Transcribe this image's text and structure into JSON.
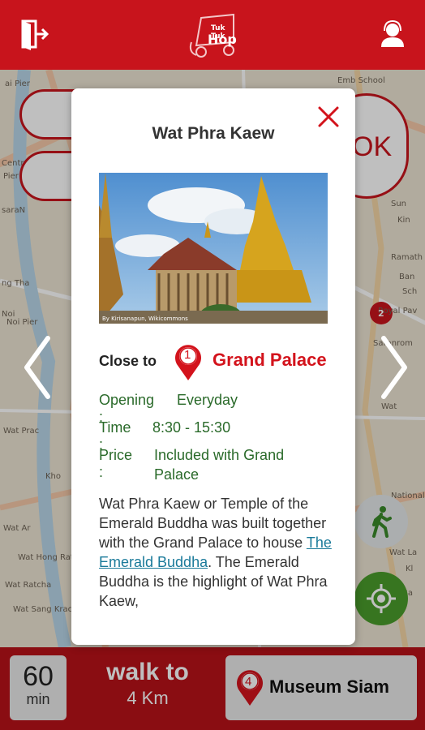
{
  "header": {
    "logo_line1": "Tuk Tuk",
    "logo_line2": "Hop",
    "exit_icon": "exit-door-icon",
    "profile_icon": "user-headset-icon"
  },
  "map": {
    "labels": [
      "ai Pier",
      "Centr",
      "Pier",
      "saraN",
      "ng Tha",
      "Noi",
      "Noi Pier",
      "Wat Hong Rat",
      "Wat Sang Krachai Pier",
      "Kho",
      "Ramath",
      "Royal Pav",
      "Saranrom",
      "National",
      "Sun",
      "Kin",
      "Ban",
      "Sch",
      "Wat",
      "Wat La",
      "Wat Prac",
      "Emb School",
      "Wat Ar",
      "Wat Ratcha",
      "Kl",
      "Ba"
    ],
    "ok_text": "OK",
    "marker_number": "2"
  },
  "modal": {
    "title": "Wat Phra Kaew",
    "photo_credit": "By Kirisanapun, Wikicommons",
    "close_to_label": "Close to",
    "close_to_number": "1",
    "close_to_place": "Grand Palace",
    "opening_key": "Opening :",
    "opening_val": "Everyday",
    "time_key": "Time :",
    "time_val": "8:30 - 15:30",
    "price_key": "Price :",
    "price_val_line1": "Included with Grand",
    "price_val_line2": "Palace",
    "desc_part1": "Wat Phra Kaew or Temple of the Emerald Buddha was built together with the Grand Palace to house ",
    "desc_link": "The Emerald Buddha",
    "desc_part2": ". The Emerald Buddha is the highlight of Wat Phra Kaew,"
  },
  "bottom": {
    "minutes": "60",
    "minutes_unit": "min",
    "walk_title": "walk to",
    "walk_distance": "4 Km",
    "dest_number": "4",
    "dest_name": "Museum Siam"
  },
  "colors": {
    "brand_red": "#c8141c",
    "pin_red": "#d3131c",
    "info_green": "#2a6a2a",
    "locate_green": "#4a9d2b"
  }
}
